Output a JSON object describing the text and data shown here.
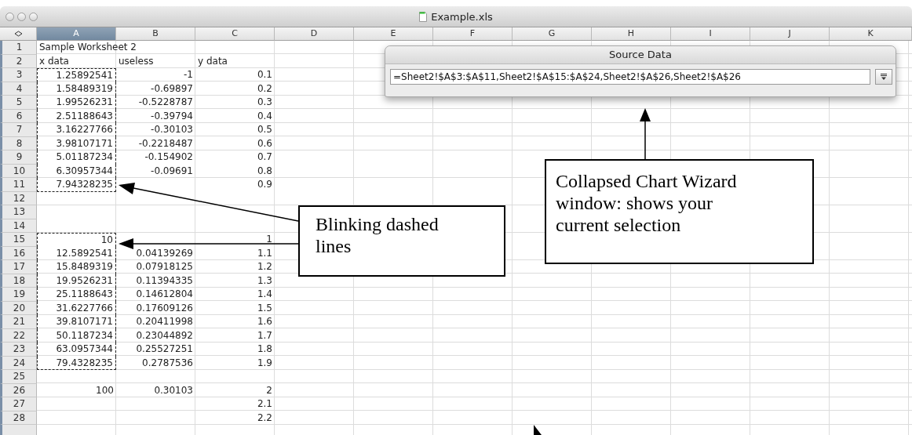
{
  "window": {
    "title": "Example.xls"
  },
  "columns": [
    {
      "label": "A",
      "selected": true
    },
    {
      "label": "B",
      "selected": false
    },
    {
      "label": "C",
      "selected": false
    },
    {
      "label": "D",
      "selected": false
    },
    {
      "label": "E",
      "selected": false
    },
    {
      "label": "F",
      "selected": false
    },
    {
      "label": "G",
      "selected": false
    },
    {
      "label": "H",
      "selected": false
    },
    {
      "label": "I",
      "selected": false
    },
    {
      "label": "J",
      "selected": false
    },
    {
      "label": "K",
      "selected": false
    }
  ],
  "rows": [
    {
      "number": "1",
      "kind": "label",
      "in_selection": false,
      "cells": [
        "Sample Worksheet 2"
      ]
    },
    {
      "number": "2",
      "kind": "label",
      "in_selection": false,
      "cells": [
        "x data",
        "useless",
        "y data"
      ]
    },
    {
      "number": "3",
      "kind": "number",
      "in_selection": true,
      "cells": [
        "1.25892541",
        "-1",
        "0.1"
      ]
    },
    {
      "number": "4",
      "kind": "number",
      "in_selection": true,
      "cells": [
        "1.58489319",
        "-0.69897",
        "0.2"
      ]
    },
    {
      "number": "5",
      "kind": "number",
      "in_selection": true,
      "cells": [
        "1.99526231",
        "-0.5228787",
        "0.3"
      ]
    },
    {
      "number": "6",
      "kind": "number",
      "in_selection": true,
      "cells": [
        "2.51188643",
        "-0.39794",
        "0.4"
      ]
    },
    {
      "number": "7",
      "kind": "number",
      "in_selection": true,
      "cells": [
        "3.16227766",
        "-0.30103",
        "0.5"
      ]
    },
    {
      "number": "8",
      "kind": "number",
      "in_selection": true,
      "cells": [
        "3.98107171",
        "-0.2218487",
        "0.6"
      ]
    },
    {
      "number": "9",
      "kind": "number",
      "in_selection": true,
      "cells": [
        "5.01187234",
        "-0.154902",
        "0.7"
      ]
    },
    {
      "number": "10",
      "kind": "number",
      "in_selection": true,
      "cells": [
        "6.30957344",
        "-0.09691",
        "0.8"
      ]
    },
    {
      "number": "11",
      "kind": "number",
      "in_selection": true,
      "cells": [
        "7.94328235",
        "",
        "0.9"
      ]
    },
    {
      "number": "12",
      "kind": "number",
      "in_selection": false,
      "cells": []
    },
    {
      "number": "13",
      "kind": "number",
      "in_selection": false,
      "cells": []
    },
    {
      "number": "14",
      "kind": "number",
      "in_selection": false,
      "cells": []
    },
    {
      "number": "15",
      "kind": "number",
      "in_selection": true,
      "cells": [
        "10",
        "",
        "1"
      ]
    },
    {
      "number": "16",
      "kind": "number",
      "in_selection": true,
      "cells": [
        "12.5892541",
        "0.04139269",
        "1.1"
      ]
    },
    {
      "number": "17",
      "kind": "number",
      "in_selection": true,
      "cells": [
        "15.8489319",
        "0.07918125",
        "1.2"
      ]
    },
    {
      "number": "18",
      "kind": "number",
      "in_selection": true,
      "cells": [
        "19.9526231",
        "0.11394335",
        "1.3"
      ]
    },
    {
      "number": "19",
      "kind": "number",
      "in_selection": true,
      "cells": [
        "25.1188643",
        "0.14612804",
        "1.4"
      ]
    },
    {
      "number": "20",
      "kind": "number",
      "in_selection": true,
      "cells": [
        "31.6227766",
        "0.17609126",
        "1.5"
      ]
    },
    {
      "number": "21",
      "kind": "number",
      "in_selection": true,
      "cells": [
        "39.8107171",
        "0.20411998",
        "1.6"
      ]
    },
    {
      "number": "22",
      "kind": "number",
      "in_selection": true,
      "cells": [
        "50.1187234",
        "0.23044892",
        "1.7"
      ]
    },
    {
      "number": "23",
      "kind": "number",
      "in_selection": true,
      "cells": [
        "63.0957344",
        "0.25527251",
        "1.8"
      ]
    },
    {
      "number": "24",
      "kind": "number",
      "in_selection": true,
      "cells": [
        "79.4328235",
        "0.2787536",
        "1.9"
      ]
    },
    {
      "number": "25",
      "kind": "number",
      "in_selection": false,
      "cells": []
    },
    {
      "number": "26",
      "kind": "number",
      "in_selection": false,
      "cells": [
        "100",
        "0.30103",
        "2"
      ]
    },
    {
      "number": "27",
      "kind": "number",
      "in_selection": false,
      "cells": [
        "",
        "",
        "2.1"
      ]
    },
    {
      "number": "28",
      "kind": "number",
      "in_selection": false,
      "cells": [
        "",
        "",
        "2.2"
      ]
    }
  ],
  "source_data": {
    "title": "Source Data",
    "value": "=Sheet2!$A$3:$A$11,Sheet2!$A$15:$A$24,Sheet2!$A$26,Sheet2!$A$26"
  },
  "callouts": [
    {
      "text": "Blinking dashed lines"
    },
    {
      "text": "Collapsed Chart Wizard window: shows your current selection"
    }
  ]
}
